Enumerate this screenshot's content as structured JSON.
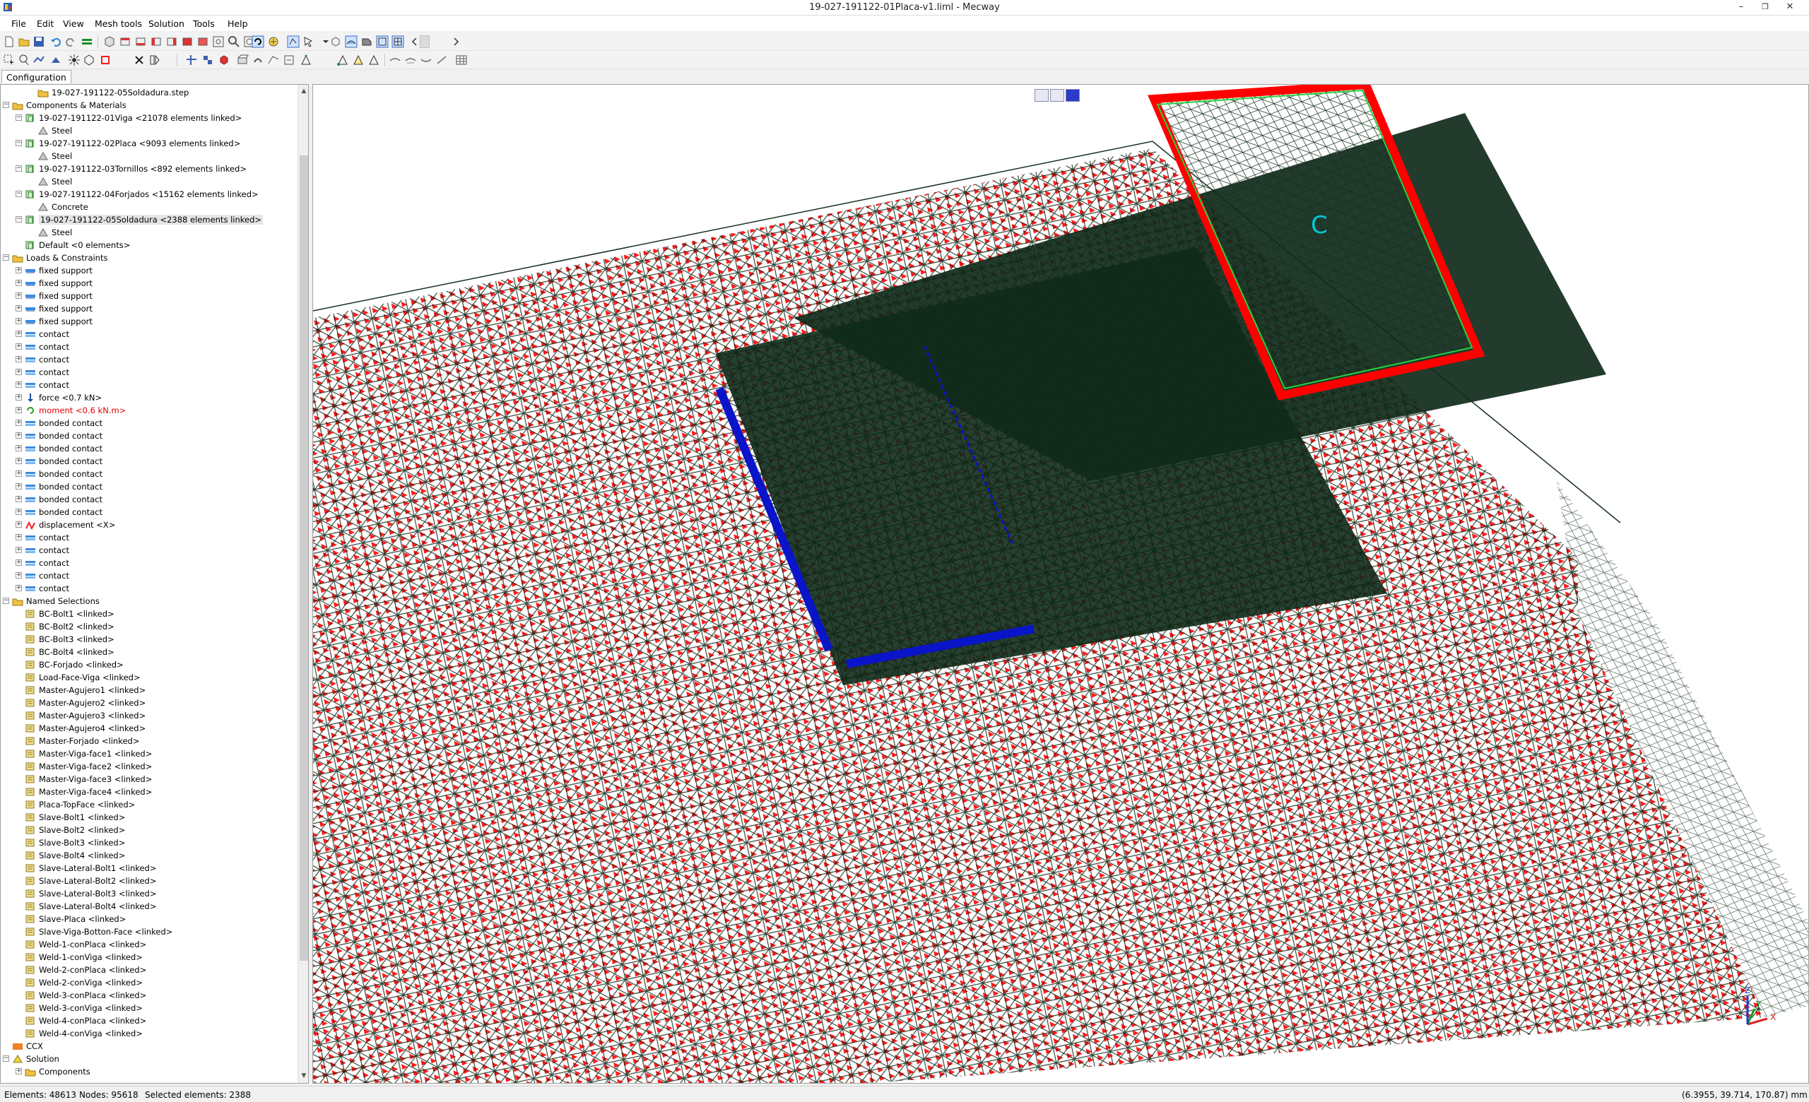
{
  "window": {
    "title": "19-027-191122-01Placa-v1.liml - Mecway",
    "minimize": "–",
    "restore": "❐",
    "close": "✕"
  },
  "menu": [
    {
      "label": "File"
    },
    {
      "label": "Edit"
    },
    {
      "label": "View"
    },
    {
      "label": "Mesh tools"
    },
    {
      "label": "Solution"
    },
    {
      "label": "Tools"
    },
    {
      "label": "Help"
    }
  ],
  "tabs": {
    "configuration": "Configuration"
  },
  "tree": {
    "items": [
      {
        "label": "19-027-191122-05Soldadura.step",
        "level": 2,
        "icon": "step-file-icon"
      },
      {
        "label": "Components & Materials",
        "level": 0,
        "icon": "folder-icon",
        "expander": "−"
      },
      {
        "label": "19-027-191122-01Viga <21078 elements linked>",
        "level": 1,
        "icon": "component-icon",
        "expander": "−"
      },
      {
        "label": "Steel",
        "level": 2,
        "icon": "material-icon"
      },
      {
        "label": "19-027-191122-02Placa <9093 elements linked>",
        "level": 1,
        "icon": "component-icon",
        "expander": "−"
      },
      {
        "label": "Steel",
        "level": 2,
        "icon": "material-icon"
      },
      {
        "label": "19-027-191122-03Tornillos <892 elements linked>",
        "level": 1,
        "icon": "component-icon",
        "expander": "−"
      },
      {
        "label": "Steel",
        "level": 2,
        "icon": "material-icon"
      },
      {
        "label": "19-027-191122-04Forjados <15162 elements linked>",
        "level": 1,
        "icon": "component-icon",
        "expander": "−"
      },
      {
        "label": "Concrete",
        "level": 2,
        "icon": "material-icon"
      },
      {
        "label": "19-027-191122-05Soldadura <2388 elements linked>",
        "level": 1,
        "icon": "component-icon",
        "expander": "−",
        "selected": true
      },
      {
        "label": "Steel",
        "level": 2,
        "icon": "material-icon"
      },
      {
        "label": "Default <0 elements>",
        "level": 1,
        "icon": "component-icon"
      },
      {
        "label": "Loads & Constraints",
        "level": 0,
        "icon": "folder-icon",
        "expander": "−"
      },
      {
        "label": "fixed support",
        "level": 1,
        "icon": "constraint-icon",
        "expander": "+"
      },
      {
        "label": "fixed support",
        "level": 1,
        "icon": "constraint-icon",
        "expander": "+"
      },
      {
        "label": "fixed support",
        "level": 1,
        "icon": "constraint-icon",
        "expander": "+"
      },
      {
        "label": "fixed support",
        "level": 1,
        "icon": "constraint-icon",
        "expander": "+"
      },
      {
        "label": "fixed support",
        "level": 1,
        "icon": "constraint-icon",
        "expander": "+"
      },
      {
        "label": "contact",
        "level": 1,
        "icon": "contact-icon",
        "expander": "+"
      },
      {
        "label": "contact",
        "level": 1,
        "icon": "contact-icon",
        "expander": "+"
      },
      {
        "label": "contact",
        "level": 1,
        "icon": "contact-icon",
        "expander": "+"
      },
      {
        "label": "contact",
        "level": 1,
        "icon": "contact-icon",
        "expander": "+"
      },
      {
        "label": "contact",
        "level": 1,
        "icon": "contact-icon",
        "expander": "+"
      },
      {
        "label": "force <0.7 kN>",
        "level": 1,
        "icon": "force-icon",
        "expander": "+"
      },
      {
        "label": "moment <0.6 kN.m>",
        "level": 1,
        "icon": "moment-icon",
        "expander": "+",
        "red": true
      },
      {
        "label": "bonded contact",
        "level": 1,
        "icon": "contact-icon",
        "expander": "+"
      },
      {
        "label": "bonded contact",
        "level": 1,
        "icon": "contact-icon",
        "expander": "+"
      },
      {
        "label": "bonded contact",
        "level": 1,
        "icon": "contact-icon",
        "expander": "+"
      },
      {
        "label": "bonded contact",
        "level": 1,
        "icon": "contact-icon",
        "expander": "+"
      },
      {
        "label": "bonded contact",
        "level": 1,
        "icon": "contact-icon",
        "expander": "+"
      },
      {
        "label": "bonded contact",
        "level": 1,
        "icon": "contact-icon",
        "expander": "+"
      },
      {
        "label": "bonded contact",
        "level": 1,
        "icon": "contact-icon",
        "expander": "+"
      },
      {
        "label": "bonded contact",
        "level": 1,
        "icon": "contact-icon",
        "expander": "+"
      },
      {
        "label": "displacement <X>",
        "level": 1,
        "icon": "displacement-icon",
        "expander": "+"
      },
      {
        "label": "contact",
        "level": 1,
        "icon": "contact-icon",
        "expander": "+"
      },
      {
        "label": "contact",
        "level": 1,
        "icon": "contact-icon",
        "expander": "+"
      },
      {
        "label": "contact",
        "level": 1,
        "icon": "contact-icon",
        "expander": "+"
      },
      {
        "label": "contact",
        "level": 1,
        "icon": "contact-icon",
        "expander": "+"
      },
      {
        "label": "contact",
        "level": 1,
        "icon": "contact-icon",
        "expander": "+"
      },
      {
        "label": "Named Selections",
        "level": 0,
        "icon": "folder-icon",
        "expander": "−"
      },
      {
        "label": "BC-Bolt1 <linked>",
        "level": 1,
        "icon": "selection-icon"
      },
      {
        "label": "BC-Bolt2 <linked>",
        "level": 1,
        "icon": "selection-icon"
      },
      {
        "label": "BC-Bolt3 <linked>",
        "level": 1,
        "icon": "selection-icon"
      },
      {
        "label": "BC-Bolt4 <linked>",
        "level": 1,
        "icon": "selection-icon"
      },
      {
        "label": "BC-Forjado <linked>",
        "level": 1,
        "icon": "selection-icon"
      },
      {
        "label": "Load-Face-Viga <linked>",
        "level": 1,
        "icon": "selection-icon"
      },
      {
        "label": "Master-Agujero1 <linked>",
        "level": 1,
        "icon": "selection-icon"
      },
      {
        "label": "Master-Agujero2 <linked>",
        "level": 1,
        "icon": "selection-icon"
      },
      {
        "label": "Master-Agujero3 <linked>",
        "level": 1,
        "icon": "selection-icon"
      },
      {
        "label": "Master-Agujero4 <linked>",
        "level": 1,
        "icon": "selection-icon"
      },
      {
        "label": "Master-Forjado <linked>",
        "level": 1,
        "icon": "selection-icon"
      },
      {
        "label": "Master-Viga-face1 <linked>",
        "level": 1,
        "icon": "selection-icon"
      },
      {
        "label": "Master-Viga-face2 <linked>",
        "level": 1,
        "icon": "selection-icon"
      },
      {
        "label": "Master-Viga-face3 <linked>",
        "level": 1,
        "icon": "selection-icon"
      },
      {
        "label": "Master-Viga-face4 <linked>",
        "level": 1,
        "icon": "selection-icon"
      },
      {
        "label": "Placa-TopFace <linked>",
        "level": 1,
        "icon": "selection-icon"
      },
      {
        "label": "Slave-Bolt1 <linked>",
        "level": 1,
        "icon": "selection-icon"
      },
      {
        "label": "Slave-Bolt2 <linked>",
        "level": 1,
        "icon": "selection-icon"
      },
      {
        "label": "Slave-Bolt3 <linked>",
        "level": 1,
        "icon": "selection-icon"
      },
      {
        "label": "Slave-Bolt4 <linked>",
        "level": 1,
        "icon": "selection-icon"
      },
      {
        "label": "Slave-Lateral-Bolt1 <linked>",
        "level": 1,
        "icon": "selection-icon"
      },
      {
        "label": "Slave-Lateral-Bolt2 <linked>",
        "level": 1,
        "icon": "selection-icon"
      },
      {
        "label": "Slave-Lateral-Bolt3 <linked>",
        "level": 1,
        "icon": "selection-icon"
      },
      {
        "label": "Slave-Lateral-Bolt4 <linked>",
        "level": 1,
        "icon": "selection-icon"
      },
      {
        "label": "Slave-Placa <linked>",
        "level": 1,
        "icon": "selection-icon"
      },
      {
        "label": "Slave-Viga-Botton-Face <linked>",
        "level": 1,
        "icon": "selection-icon"
      },
      {
        "label": "Weld-1-conPlaca <linked>",
        "level": 1,
        "icon": "selection-icon"
      },
      {
        "label": "Weld-1-conViga <linked>",
        "level": 1,
        "icon": "selection-icon"
      },
      {
        "label": "Weld-2-conPlaca <linked>",
        "level": 1,
        "icon": "selection-icon"
      },
      {
        "label": "Weld-2-conViga <linked>",
        "level": 1,
        "icon": "selection-icon"
      },
      {
        "label": "Weld-3-conPlaca <linked>",
        "level": 1,
        "icon": "selection-icon"
      },
      {
        "label": "Weld-3-conViga <linked>",
        "level": 1,
        "icon": "selection-icon"
      },
      {
        "label": "Weld-4-conPlaca <linked>",
        "level": 1,
        "icon": "selection-icon"
      },
      {
        "label": "Weld-4-conViga <linked>",
        "level": 1,
        "icon": "selection-icon"
      },
      {
        "label": "CCX",
        "level": 0,
        "icon": "solver-icon"
      },
      {
        "label": "Solution",
        "level": 0,
        "icon": "solution-icon",
        "expander": "−"
      },
      {
        "label": "Components",
        "level": 1,
        "icon": "folder-icon",
        "expander": "+"
      }
    ]
  },
  "viewport": {
    "mesh_color": "#0f2a1a",
    "constraint_color": "#ff1a1a",
    "weld_color": "#0a14c8",
    "face_highlight": "#ff0000",
    "axes": {
      "x": "X",
      "y": "Y",
      "z": "Z"
    }
  },
  "status": {
    "elements": "Elements: 48613",
    "nodes": "Nodes: 95618",
    "selected": "Selected elements: 2388",
    "coords": "(6.3955, 39.714, 170.87) mm"
  }
}
